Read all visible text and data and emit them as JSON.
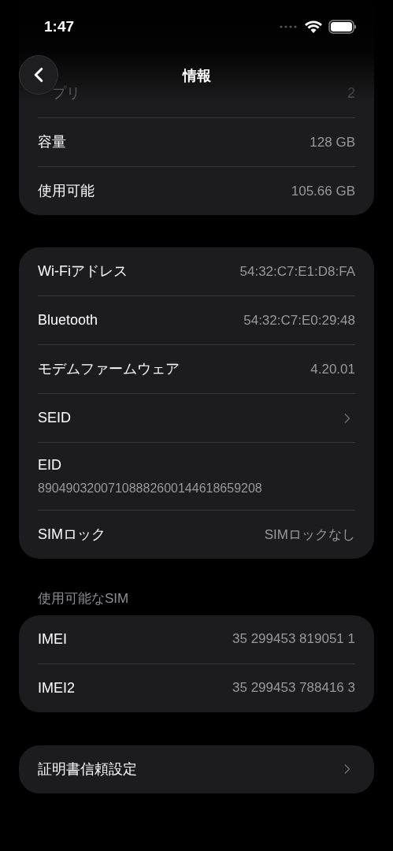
{
  "status_bar": {
    "time": "1:47"
  },
  "nav": {
    "title": "情報"
  },
  "groups": [
    {
      "rows": [
        {
          "label": "プリ",
          "value": "2",
          "kind": "faded"
        },
        {
          "label": "容量",
          "value": "128 GB",
          "kind": "value"
        },
        {
          "label": "使用可能",
          "value": "105.66 GB",
          "kind": "value"
        }
      ]
    },
    {
      "rows": [
        {
          "label": "Wi-Fiアドレス",
          "value": "54:32:C7:E1:D8:FA",
          "kind": "value"
        },
        {
          "label": "Bluetooth",
          "value": "54:32:C7:E0:29:48",
          "kind": "value"
        },
        {
          "label": "モデムファームウェア",
          "value": "4.20.01",
          "kind": "value"
        },
        {
          "label": "SEID",
          "kind": "link"
        },
        {
          "label": "EID",
          "value": "89049032007108882600144618659208",
          "kind": "stacked"
        },
        {
          "label": "SIMロック",
          "value": "SIMロックなし",
          "kind": "value"
        }
      ]
    },
    {
      "header": "使用可能なSIM",
      "rows": [
        {
          "label": "IMEI",
          "value": "35 299453 819051 1",
          "kind": "value"
        },
        {
          "label": "IMEI2",
          "value": "35 299453 788416 3",
          "kind": "value"
        }
      ]
    },
    {
      "rows": [
        {
          "label": "証明書信頼設定",
          "kind": "link"
        }
      ]
    }
  ]
}
